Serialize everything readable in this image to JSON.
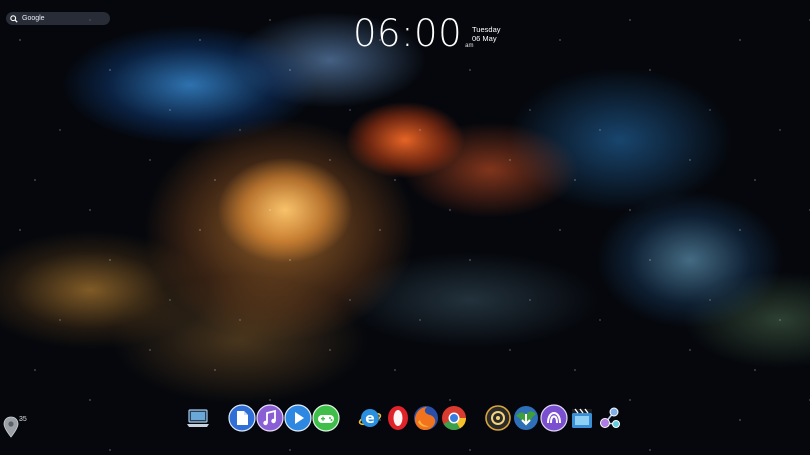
{
  "search": {
    "label": "Google",
    "icon": "search-icon"
  },
  "clock": {
    "time": "06:00",
    "ampm": "am",
    "weekday": "Tuesday",
    "date": "06 May"
  },
  "weather": {
    "icon": "map-pin-icon",
    "temperature": "35"
  },
  "dock": {
    "icons": [
      {
        "name": "computer-icon",
        "color": "#6aa8d8"
      },
      {
        "name": "documents-icon",
        "color": "#2f6fd6"
      },
      {
        "name": "music-icon",
        "color": "#8a5fd6"
      },
      {
        "name": "video-player-icon",
        "color": "#2e87e0"
      },
      {
        "name": "games-icon",
        "color": "#3fbf4a"
      },
      {
        "name": "internet-explorer-icon",
        "color": "#2b8fe0"
      },
      {
        "name": "opera-icon",
        "color": "#e0222b"
      },
      {
        "name": "firefox-icon",
        "color": "#f2731d"
      },
      {
        "name": "chrome-icon",
        "color": "#d93b31"
      },
      {
        "name": "media-icon",
        "color": "#d9a43b"
      },
      {
        "name": "internet-download-manager-icon",
        "color": "#3f9f3a"
      },
      {
        "name": "bittorrent-icon",
        "color": "#7a4fd0"
      },
      {
        "name": "video-editor-icon",
        "color": "#3a8fd6"
      },
      {
        "name": "share-icon",
        "color": "#7fb0e8"
      }
    ]
  }
}
